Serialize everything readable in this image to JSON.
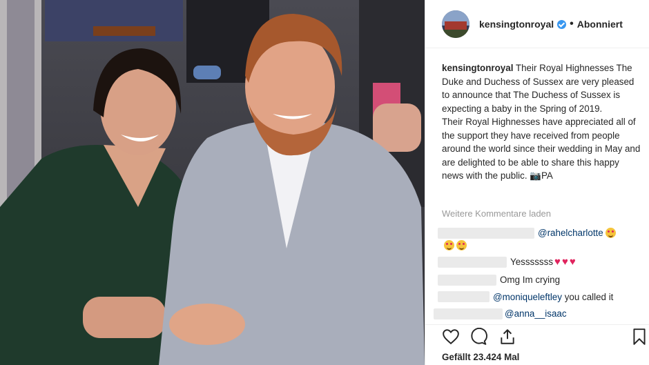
{
  "post": {
    "username": "kensingtonroyal",
    "follow_status": "Abonniert",
    "caption_user": "kensingtonroyal",
    "caption_p1": "Their Royal Highnesses The Duke and Duchess of Sussex are very pleased to announce that The Duchess of Sussex is expecting a baby in the Spring of 2019.",
    "caption_p2": "Their Royal Highnesses have appreciated all of the support they have received from people around the world since their wedding in May and are delighted to be able to share this happy news with the public. 📷PA",
    "load_more": "Weitere Kommentare laden",
    "likes": "Gefällt 23.424 Mal"
  },
  "comments": [
    {
      "text": "@rahelcharlotte"
    },
    {
      "text": "Yesssssss"
    },
    {
      "text": "Omg Im crying"
    },
    {
      "mention": "@moniqueleftley",
      "text": "you called it"
    },
    {
      "text": "@anna__isaac"
    }
  ],
  "colors": {
    "accent": "#3897f0",
    "heart": "#e0245e",
    "mention": "#003569"
  },
  "icons": [
    "heart-icon",
    "comment-icon",
    "share-icon",
    "bookmark-icon",
    "verified-icon"
  ]
}
